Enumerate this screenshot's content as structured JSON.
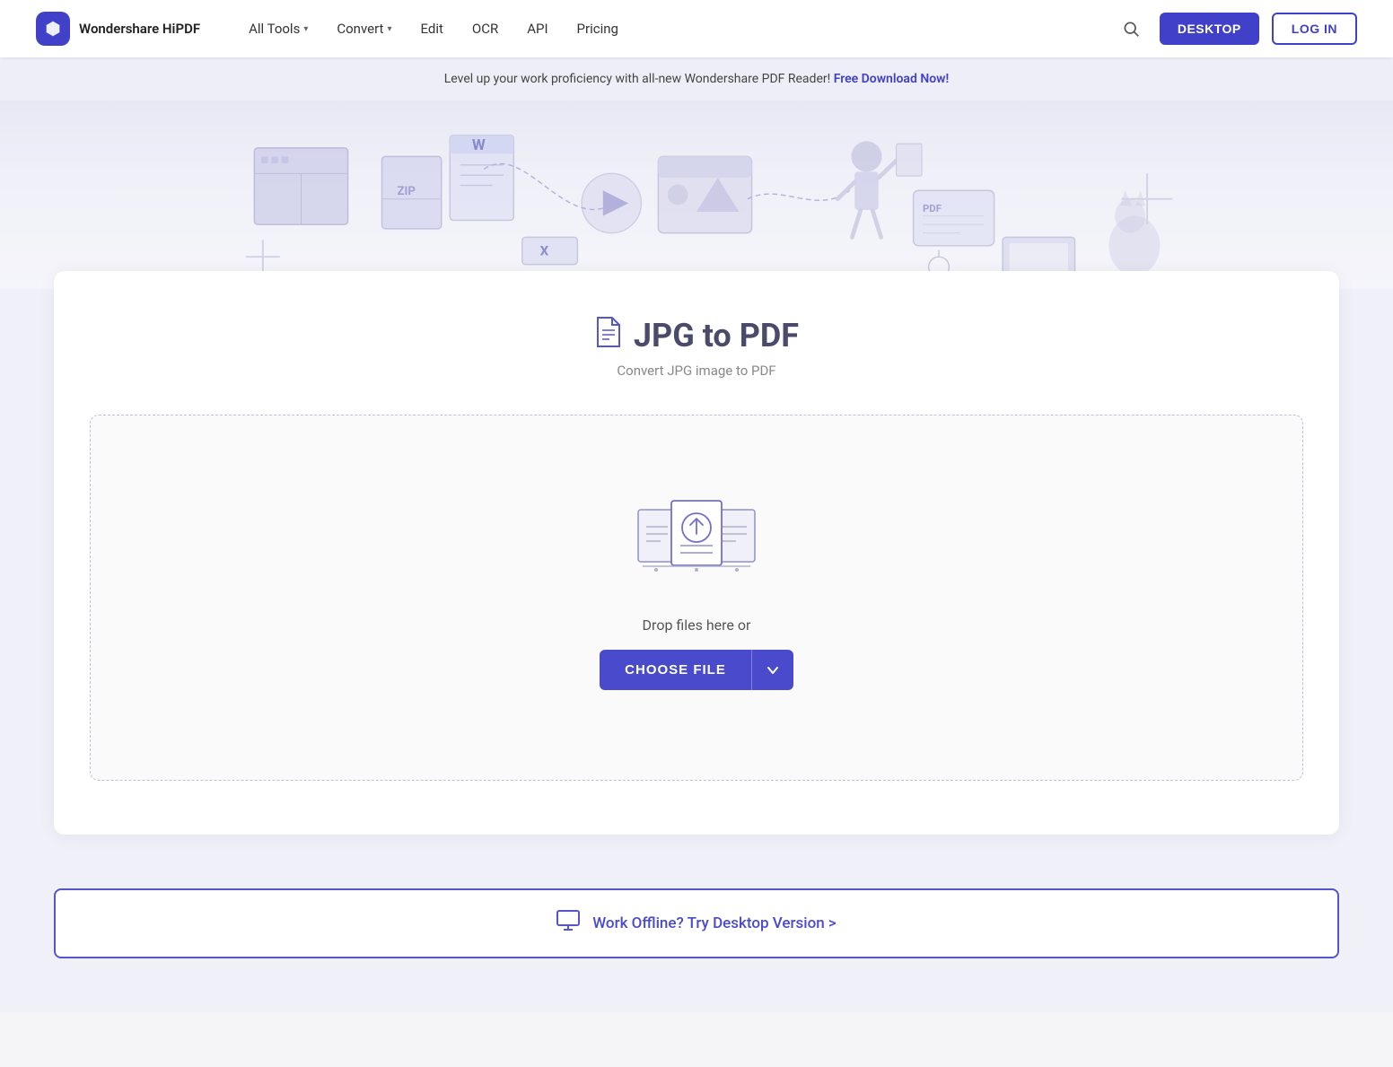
{
  "navbar": {
    "logo_text": "Wondershare HiPDF",
    "nav_items": [
      {
        "label": "All Tools",
        "has_dropdown": true
      },
      {
        "label": "Convert",
        "has_dropdown": true
      },
      {
        "label": "Edit",
        "has_dropdown": false
      },
      {
        "label": "OCR",
        "has_dropdown": false
      },
      {
        "label": "API",
        "has_dropdown": false
      },
      {
        "label": "Pricing",
        "has_dropdown": false
      }
    ],
    "btn_desktop": "DESKTOP",
    "btn_login": "LOG IN"
  },
  "banner": {
    "text": "Level up your work proficiency with all-new Wondershare PDF Reader!",
    "link_text": "Free Download Now!"
  },
  "tool": {
    "title": "JPG to PDF",
    "subtitle": "Convert JPG image to PDF",
    "drop_text": "Drop files here or",
    "choose_file_label": "CHOOSE FILE"
  },
  "desktop_promo": {
    "text": "Work Offline? Try Desktop Version >"
  },
  "colors": {
    "primary": "#4a4acc",
    "primary_dark": "#3838aa"
  }
}
